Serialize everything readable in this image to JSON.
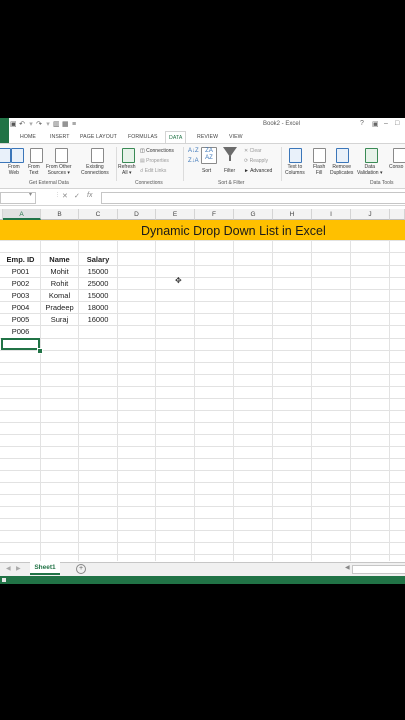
{
  "window": {
    "title": "Book2 - Excel"
  },
  "ribbon": {
    "tabs": [
      "HOME",
      "INSERT",
      "PAGE LAYOUT",
      "FORMULAS",
      "DATA",
      "REVIEW",
      "VIEW"
    ],
    "active_tab": "DATA",
    "get_external_data": {
      "from_web": [
        "From",
        "Web"
      ],
      "from_text": [
        "From",
        "Text"
      ],
      "from_other": [
        "From Other",
        "Sources ▾"
      ],
      "existing": [
        "Existing",
        "Connections"
      ],
      "group_label": "Get External Data"
    },
    "connections": {
      "refresh": [
        "Refresh",
        "All ▾"
      ],
      "connections": "Connections",
      "properties": "Properties",
      "edit_links": "Edit Links",
      "group_label": "Connections"
    },
    "sort_filter": {
      "sort": "Sort",
      "filter": "Filter",
      "clear": "Clear",
      "reapply": "Reapply",
      "advanced": "Advanced",
      "group_label": "Sort & Filter"
    },
    "data_tools": {
      "text_to_columns": [
        "Text to",
        "Columns"
      ],
      "flash_fill": [
        "Flash",
        "Fill"
      ],
      "remove_duplicates": [
        "Remove",
        "Duplicates"
      ],
      "data_validation": [
        "Data",
        "Validation ▾"
      ],
      "consolidate": "Conso",
      "group_label": "Data Tools"
    }
  },
  "formula_bar": {
    "fx": "fx",
    "cancel": "✕",
    "enter": "✓"
  },
  "sheet": {
    "columns": [
      "A",
      "B",
      "C",
      "D",
      "E",
      "F",
      "G",
      "H",
      "I",
      "J"
    ],
    "selected_column": "A",
    "title": "Dynamic Drop Down List in Excel",
    "headers": [
      "Emp. ID",
      "Name",
      "Salary"
    ],
    "rows": [
      [
        "P001",
        "Mohit",
        "15000"
      ],
      [
        "P002",
        "Rohit",
        "25000"
      ],
      [
        "P003",
        "Komal",
        "15000"
      ],
      [
        "P004",
        "Pradeep",
        "18000"
      ],
      [
        "P005",
        "Suraj",
        "16000"
      ],
      [
        "P006",
        "",
        ""
      ]
    ]
  },
  "sheet_tabs": {
    "active": "Sheet1",
    "add": "+"
  },
  "colors": {
    "excel_green": "#217346",
    "title_band": "#ffc000"
  }
}
